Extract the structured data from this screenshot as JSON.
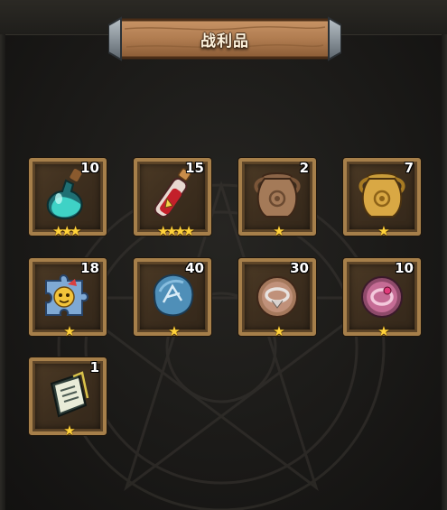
{
  "title": "战利品",
  "items": [
    {
      "name": "teal potion",
      "icon": "potion-flask-icon",
      "count": "10",
      "stars": "★★★"
    },
    {
      "name": "red scroll potion",
      "icon": "red-potion-icon",
      "count": "15",
      "stars": "★★★★"
    },
    {
      "name": "bronze urn",
      "icon": "bronze-urn-icon",
      "count": "2",
      "stars": "★"
    },
    {
      "name": "golden urn",
      "icon": "golden-urn-icon",
      "count": "7",
      "stars": "★"
    },
    {
      "name": "puzzle piece",
      "icon": "puzzle-piece-icon",
      "count": "18",
      "stars": "★"
    },
    {
      "name": "blue rune stone",
      "icon": "blue-stone-icon",
      "count": "40",
      "stars": "★"
    },
    {
      "name": "silver ring coin",
      "icon": "silver-ring-coin-icon",
      "count": "30",
      "stars": "★"
    },
    {
      "name": "pink ring coin",
      "icon": "pink-ring-coin-icon",
      "count": "10",
      "stars": "★"
    },
    {
      "name": "book",
      "icon": "book-icon",
      "count": "1",
      "stars": "★"
    }
  ]
}
